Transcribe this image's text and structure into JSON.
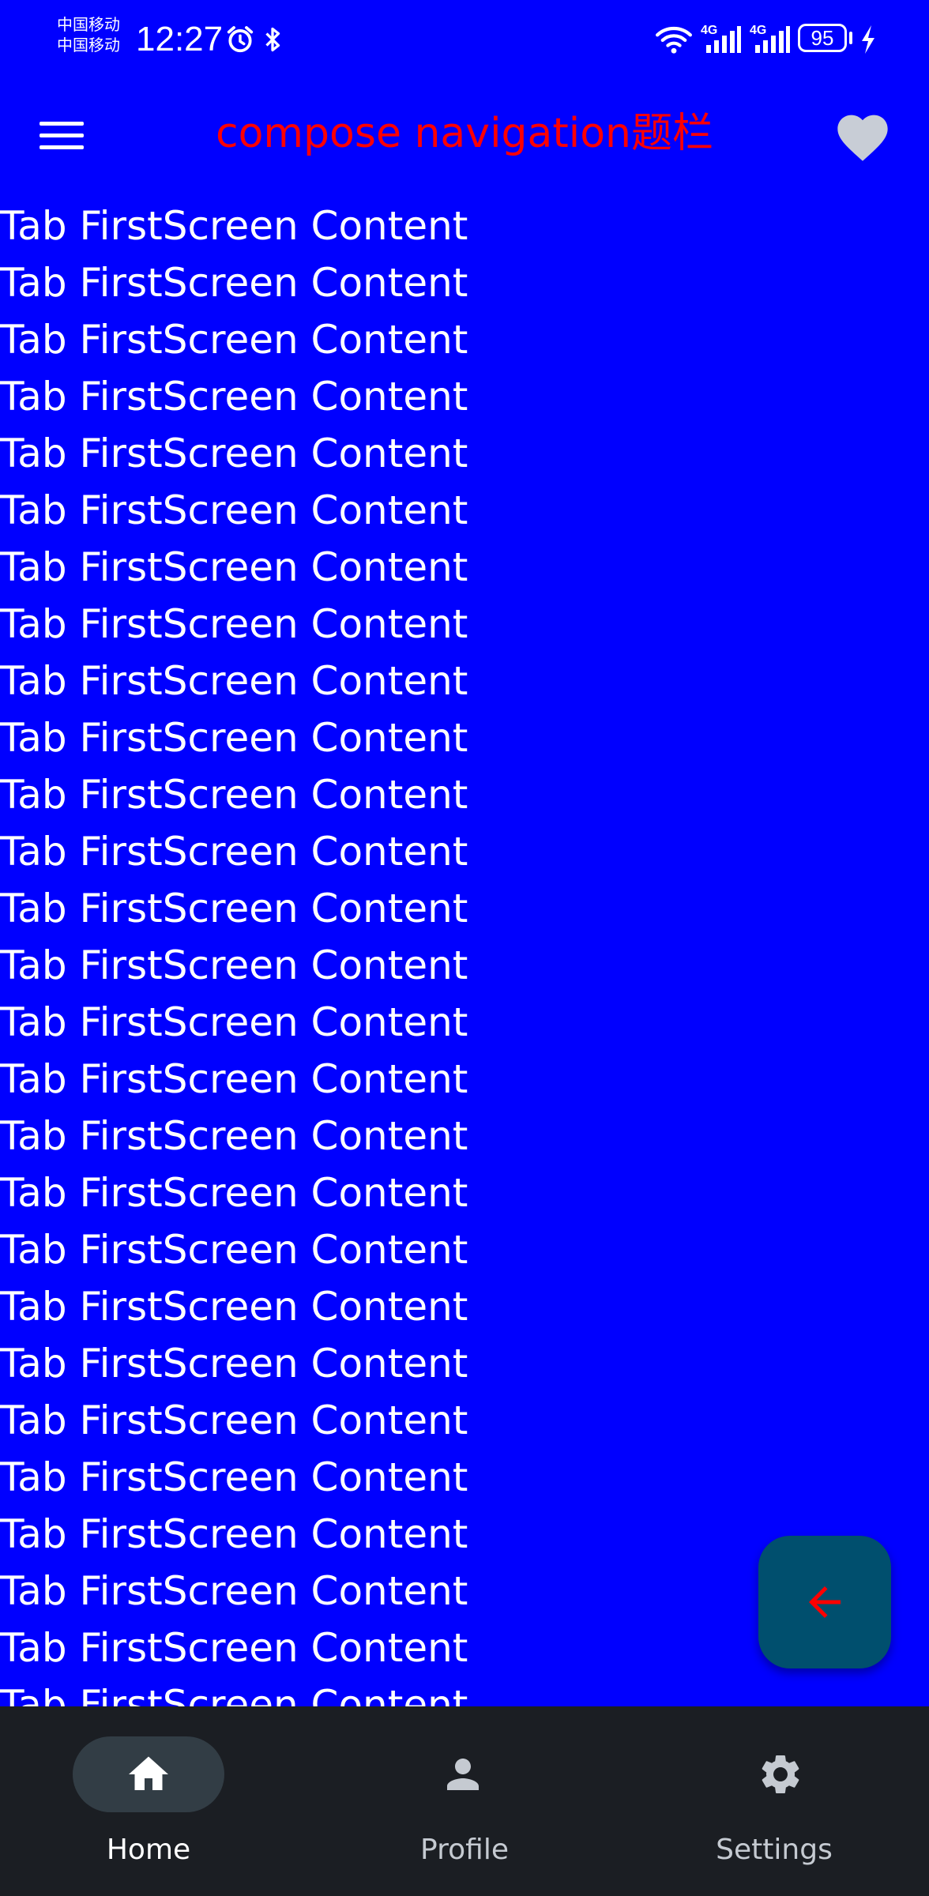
{
  "status_bar": {
    "carrier_1": "中国移动",
    "carrier_2": "中国移动",
    "time": "12:27",
    "network_1": "4G",
    "network_2": "4G",
    "battery": "95",
    "icons": [
      "alarm-icon",
      "bluetooth-icon",
      "wifi-icon",
      "signal-icon",
      "signal-icon",
      "battery-icon",
      "charging-icon"
    ]
  },
  "app_bar": {
    "title": "compose navigation题栏",
    "title_color": "#ff0000",
    "menu_icon": "menu-icon",
    "action_icon": "heart-icon"
  },
  "content": {
    "background": "#0000ff",
    "items": [
      "Tab FirstScreen Content",
      "Tab FirstScreen Content",
      "Tab FirstScreen Content",
      "Tab FirstScreen Content",
      "Tab FirstScreen Content",
      "Tab FirstScreen Content",
      "Tab FirstScreen Content",
      "Tab FirstScreen Content",
      "Tab FirstScreen Content",
      "Tab FirstScreen Content",
      "Tab FirstScreen Content",
      "Tab FirstScreen Content",
      "Tab FirstScreen Content",
      "Tab FirstScreen Content",
      "Tab FirstScreen Content",
      "Tab FirstScreen Content",
      "Tab FirstScreen Content",
      "Tab FirstScreen Content",
      "Tab FirstScreen Content",
      "Tab FirstScreen Content",
      "Tab FirstScreen Content",
      "Tab FirstScreen Content",
      "Tab FirstScreen Content",
      "Tab FirstScreen Content",
      "Tab FirstScreen Content",
      "Tab FirstScreen Content",
      "Tab FirstScreen Content"
    ]
  },
  "fab": {
    "icon": "arrow-back-icon",
    "icon_color": "#ff0000",
    "background": "#004f6e"
  },
  "bottom_nav": {
    "items": [
      {
        "label": "Home",
        "icon": "home-icon",
        "selected": true
      },
      {
        "label": "Profile",
        "icon": "person-icon",
        "selected": false
      },
      {
        "label": "Settings",
        "icon": "gear-icon",
        "selected": false
      }
    ]
  }
}
